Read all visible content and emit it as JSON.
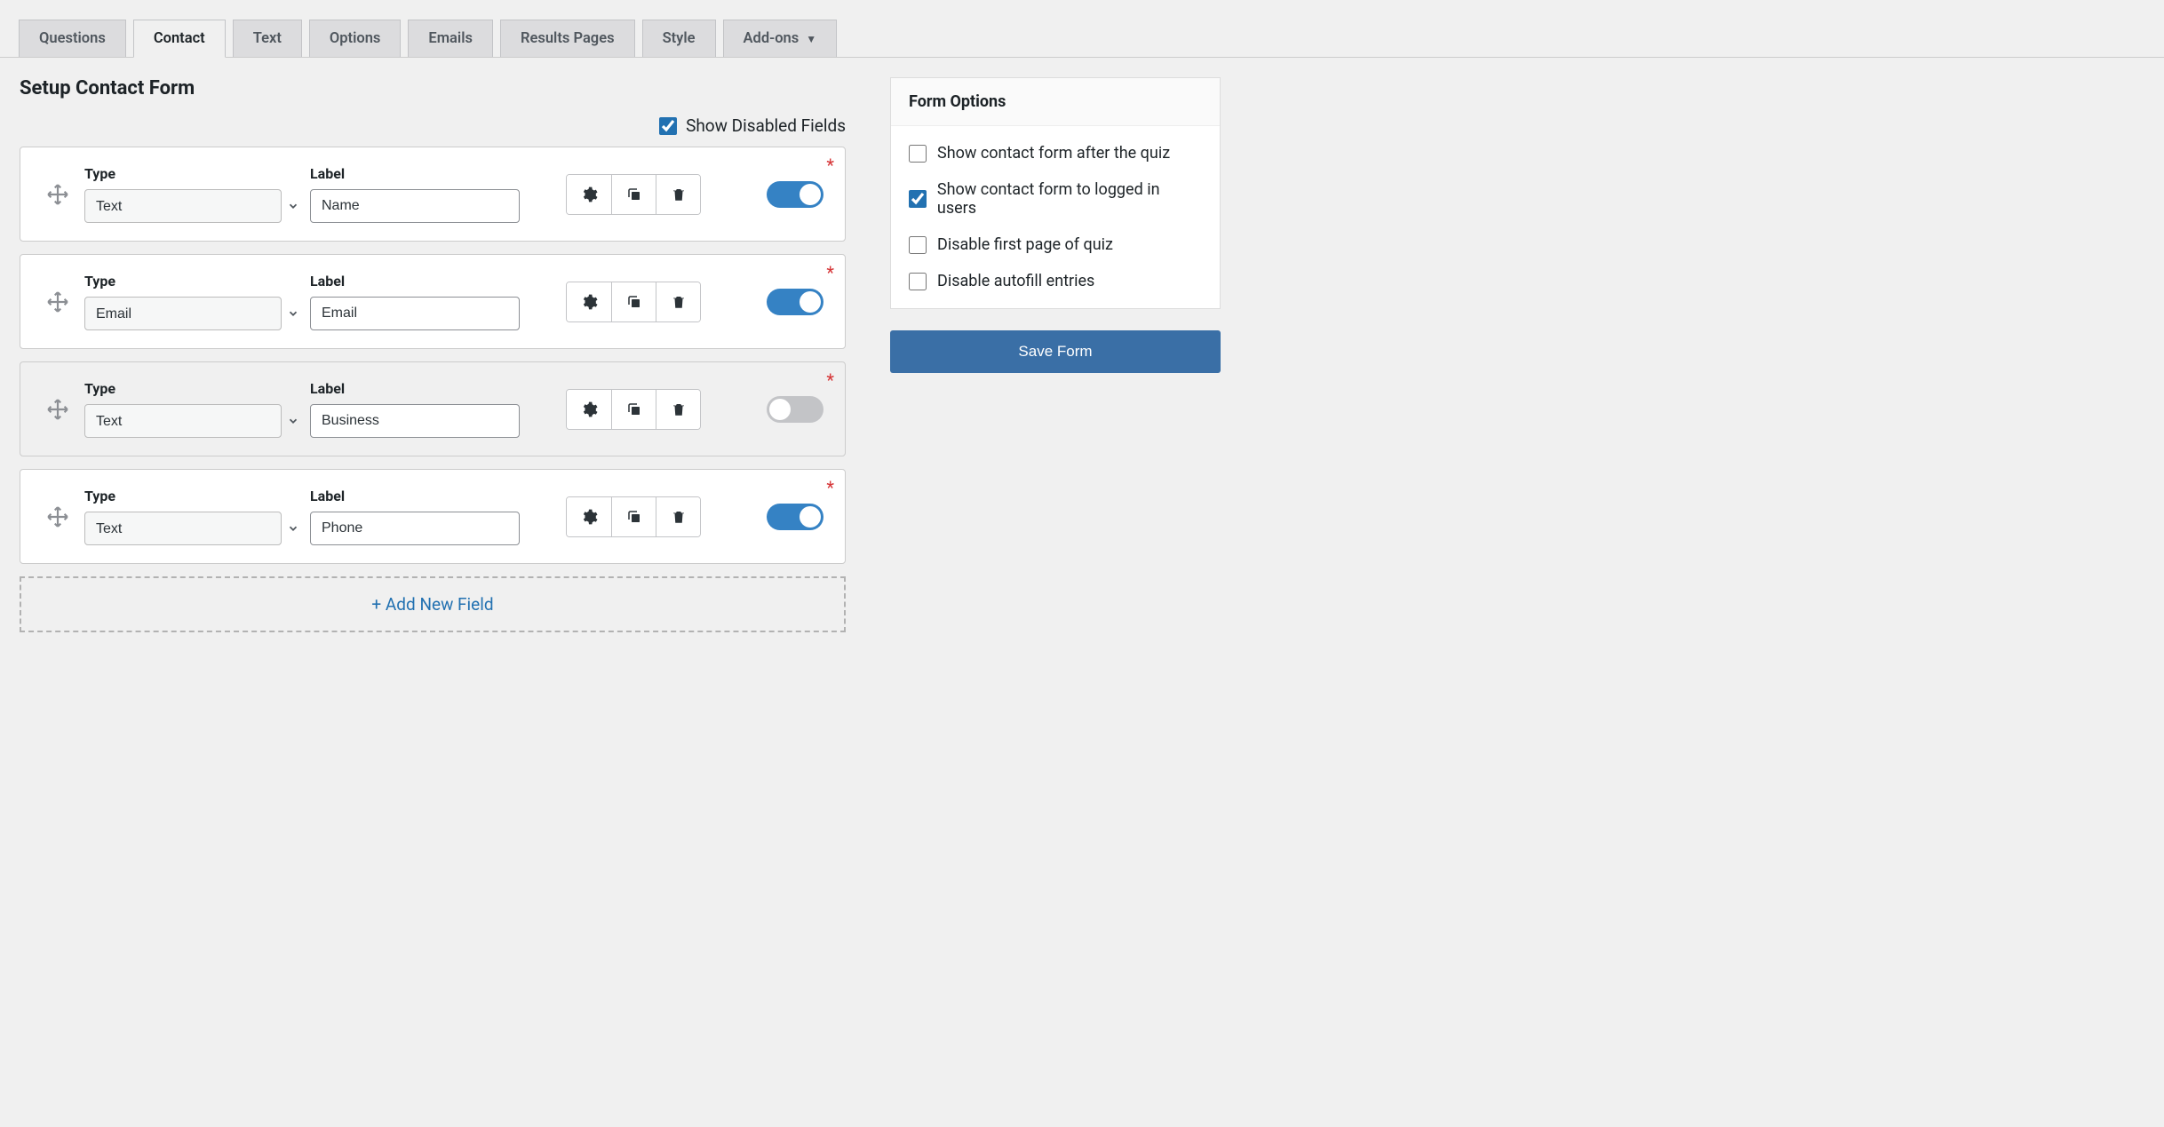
{
  "tabs": [
    {
      "label": "Questions",
      "active": false
    },
    {
      "label": "Contact",
      "active": true
    },
    {
      "label": "Text",
      "active": false
    },
    {
      "label": "Options",
      "active": false
    },
    {
      "label": "Emails",
      "active": false
    },
    {
      "label": "Results Pages",
      "active": false
    },
    {
      "label": "Style",
      "active": false
    },
    {
      "label": "Add-ons",
      "active": false,
      "has_dropdown": true
    }
  ],
  "page_title": "Setup Contact Form",
  "show_disabled": {
    "label": "Show Disabled Fields",
    "checked": true
  },
  "columns": {
    "type": "Type",
    "label": "Label"
  },
  "fields": [
    {
      "type": "Text",
      "label": "Name",
      "enabled": true,
      "required": true
    },
    {
      "type": "Email",
      "label": "Email",
      "enabled": true,
      "required": true
    },
    {
      "type": "Text",
      "label": "Business",
      "enabled": false,
      "required": true
    },
    {
      "type": "Text",
      "label": "Phone",
      "enabled": true,
      "required": true
    }
  ],
  "add_new_label": "+ Add New Field",
  "form_options": {
    "title": "Form Options",
    "items": [
      {
        "label": "Show contact form after the quiz",
        "checked": false
      },
      {
        "label": "Show contact form to logged in users",
        "checked": true
      },
      {
        "label": "Disable first page of quiz",
        "checked": false
      },
      {
        "label": "Disable autofill entries",
        "checked": false
      }
    ]
  },
  "save_label": "Save Form"
}
